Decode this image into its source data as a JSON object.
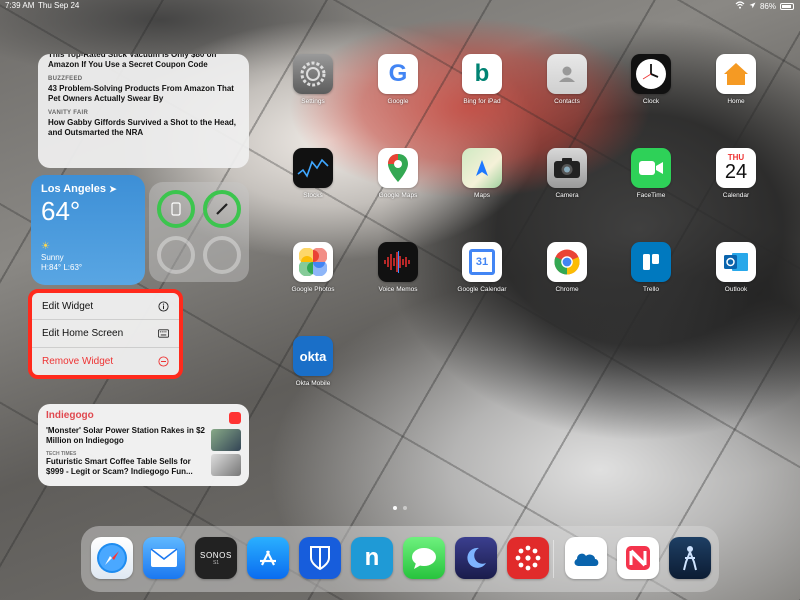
{
  "status_bar": {
    "time": "7:39 AM",
    "date": "Thu Sep 24",
    "battery": "86%"
  },
  "news_widget": {
    "items": [
      {
        "source": "",
        "headline": "This Top-Rated Stick Vacuum Is Only $80 on Amazon If You Use a Secret Coupon Code"
      },
      {
        "source": "BUZZFEED",
        "headline": "43 Problem-Solving Products From Amazon That Pet Owners Actually Swear By"
      },
      {
        "source": "VANITY FAIR",
        "headline": "How Gabby Giffords Survived a Shot to the Head, and Outsmarted the NRA"
      }
    ]
  },
  "weather": {
    "city": "Los Angeles",
    "temp": "64°",
    "condition": "Sunny",
    "high_low": "H:84° L:63°"
  },
  "context_menu": {
    "edit_widget": "Edit Widget",
    "edit_home_screen": "Edit Home Screen",
    "remove_widget": "Remove Widget",
    "highlight_color": "#ff2a1c",
    "destructive_color": "#e33333"
  },
  "indiegogo_widget": {
    "title": "Indiegogo",
    "items": [
      {
        "source": "",
        "headline": "'Monster' Solar Power Station Rakes in $2 Million on Indiegogo"
      },
      {
        "source": "TECH TIMES",
        "headline": "Futuristic Smart Coffee Table Sells for $999 - Legit or Scam? Indiegogo Fun..."
      }
    ]
  },
  "apps": {
    "settings": "Settings",
    "google": "Google",
    "bing": "Bing for iPad",
    "contacts": "Contacts",
    "clock": "Clock",
    "home": "Home",
    "stocks": "Stocks",
    "google_maps": "Google Maps",
    "maps": "Maps",
    "camera": "Camera",
    "facetime": "FaceTime",
    "calendar": "Calendar",
    "calendar_day": "THU",
    "calendar_date": "24",
    "google_photos": "Google Photos",
    "voice_memos": "Voice Memos",
    "google_calendar": "Google Calendar",
    "google_calendar_date": "31",
    "chrome": "Chrome",
    "trello": "Trello",
    "outlook": "Outlook",
    "okta": "Okta Mobile",
    "okta_text": "okta"
  },
  "dock": {
    "sonos_text": "SONOS",
    "sonos_sub": "S1"
  }
}
